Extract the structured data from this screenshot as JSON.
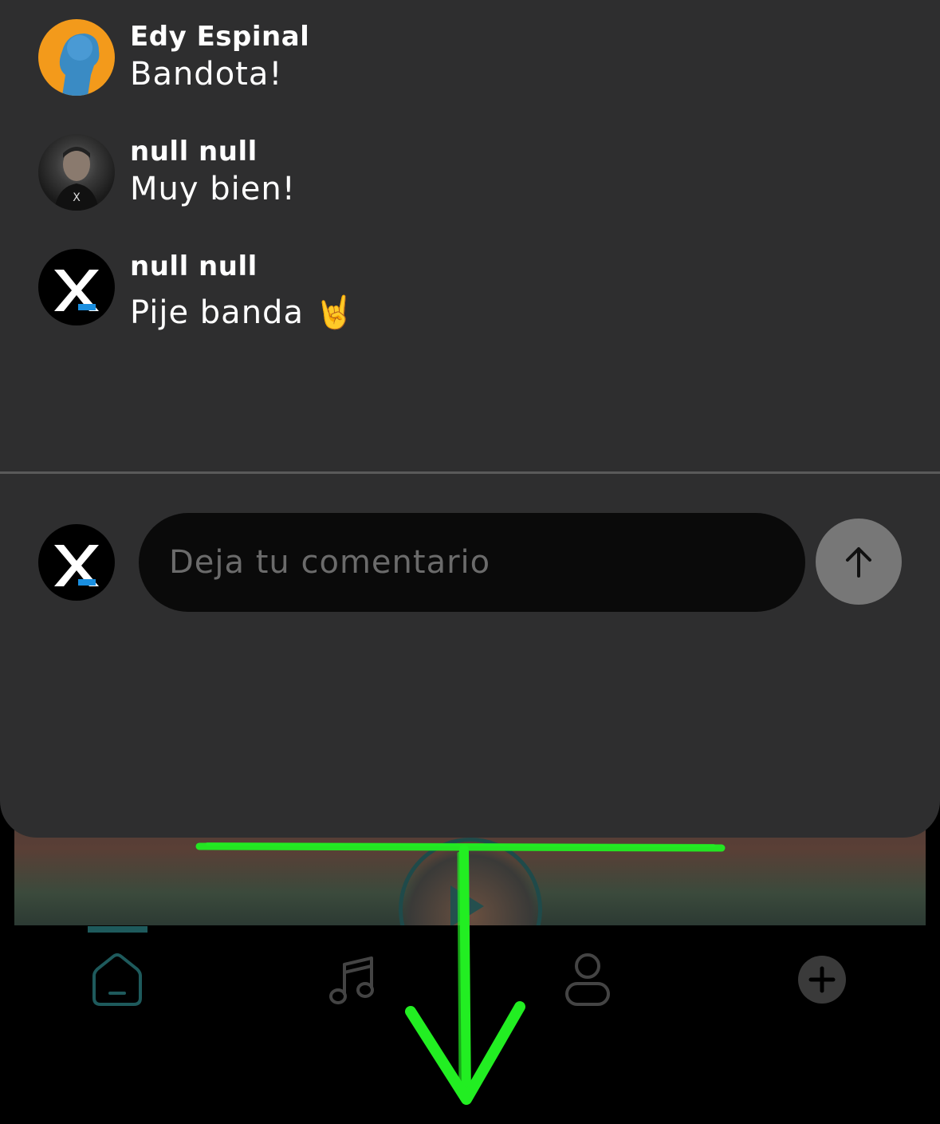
{
  "comments": [
    {
      "author": "Edy Espinal",
      "text": "Bandota!"
    },
    {
      "author": "null null",
      "text": "Muy bien!"
    },
    {
      "author": "null null",
      "text": "Pije banda 🤘"
    }
  ],
  "composer": {
    "placeholder": "Deja tu comentario",
    "send_icon": "arrow-up-icon"
  },
  "bottom_nav": {
    "items": [
      {
        "name": "home",
        "icon": "home-icon",
        "active": true
      },
      {
        "name": "music",
        "icon": "music-note-icon",
        "active": false
      },
      {
        "name": "profile",
        "icon": "user-icon",
        "active": false
      },
      {
        "name": "create",
        "icon": "plus-circle-icon",
        "active": false
      }
    ]
  },
  "colors": {
    "sheet_bg": "#2e2e2f",
    "input_bg": "#0a0a0a",
    "send_button": "#777777",
    "accent_teal": "#1e5a5c",
    "gesture_green": "#22ee22",
    "brand_blue": "#1a8fe0"
  }
}
